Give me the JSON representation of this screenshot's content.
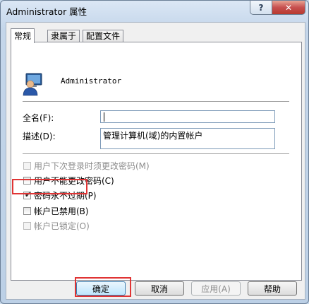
{
  "window": {
    "title": "Administrator 属性",
    "help_label": "?",
    "close_label": "✕"
  },
  "tabs": [
    {
      "label": "常规",
      "active": true
    },
    {
      "label": "隶属于",
      "active": false
    },
    {
      "label": "配置文件",
      "active": false
    }
  ],
  "user": {
    "icon": "user-account-icon",
    "name": "Administrator"
  },
  "fields": {
    "fullname_label": "全名(F):",
    "fullname_value": "",
    "description_label": "描述(D):",
    "description_value": "管理计算机(域)的内置帐户"
  },
  "checkboxes": [
    {
      "label": "用户下次登录时须更改密码(M)",
      "checked": false,
      "enabled": false
    },
    {
      "label": "用户不能更改密码(C)",
      "checked": false,
      "enabled": true
    },
    {
      "label": "密码永不过期(P)",
      "checked": true,
      "enabled": true
    },
    {
      "label": "帐户已禁用(B)",
      "checked": false,
      "enabled": true
    },
    {
      "label": "帐户已锁定(O)",
      "checked": false,
      "enabled": false
    }
  ],
  "buttons": {
    "ok": "确定",
    "cancel": "取消",
    "apply": "应用(A)",
    "help": "帮助"
  },
  "colors": {
    "highlight": "#e03434",
    "accent": "#3c7fb1"
  }
}
